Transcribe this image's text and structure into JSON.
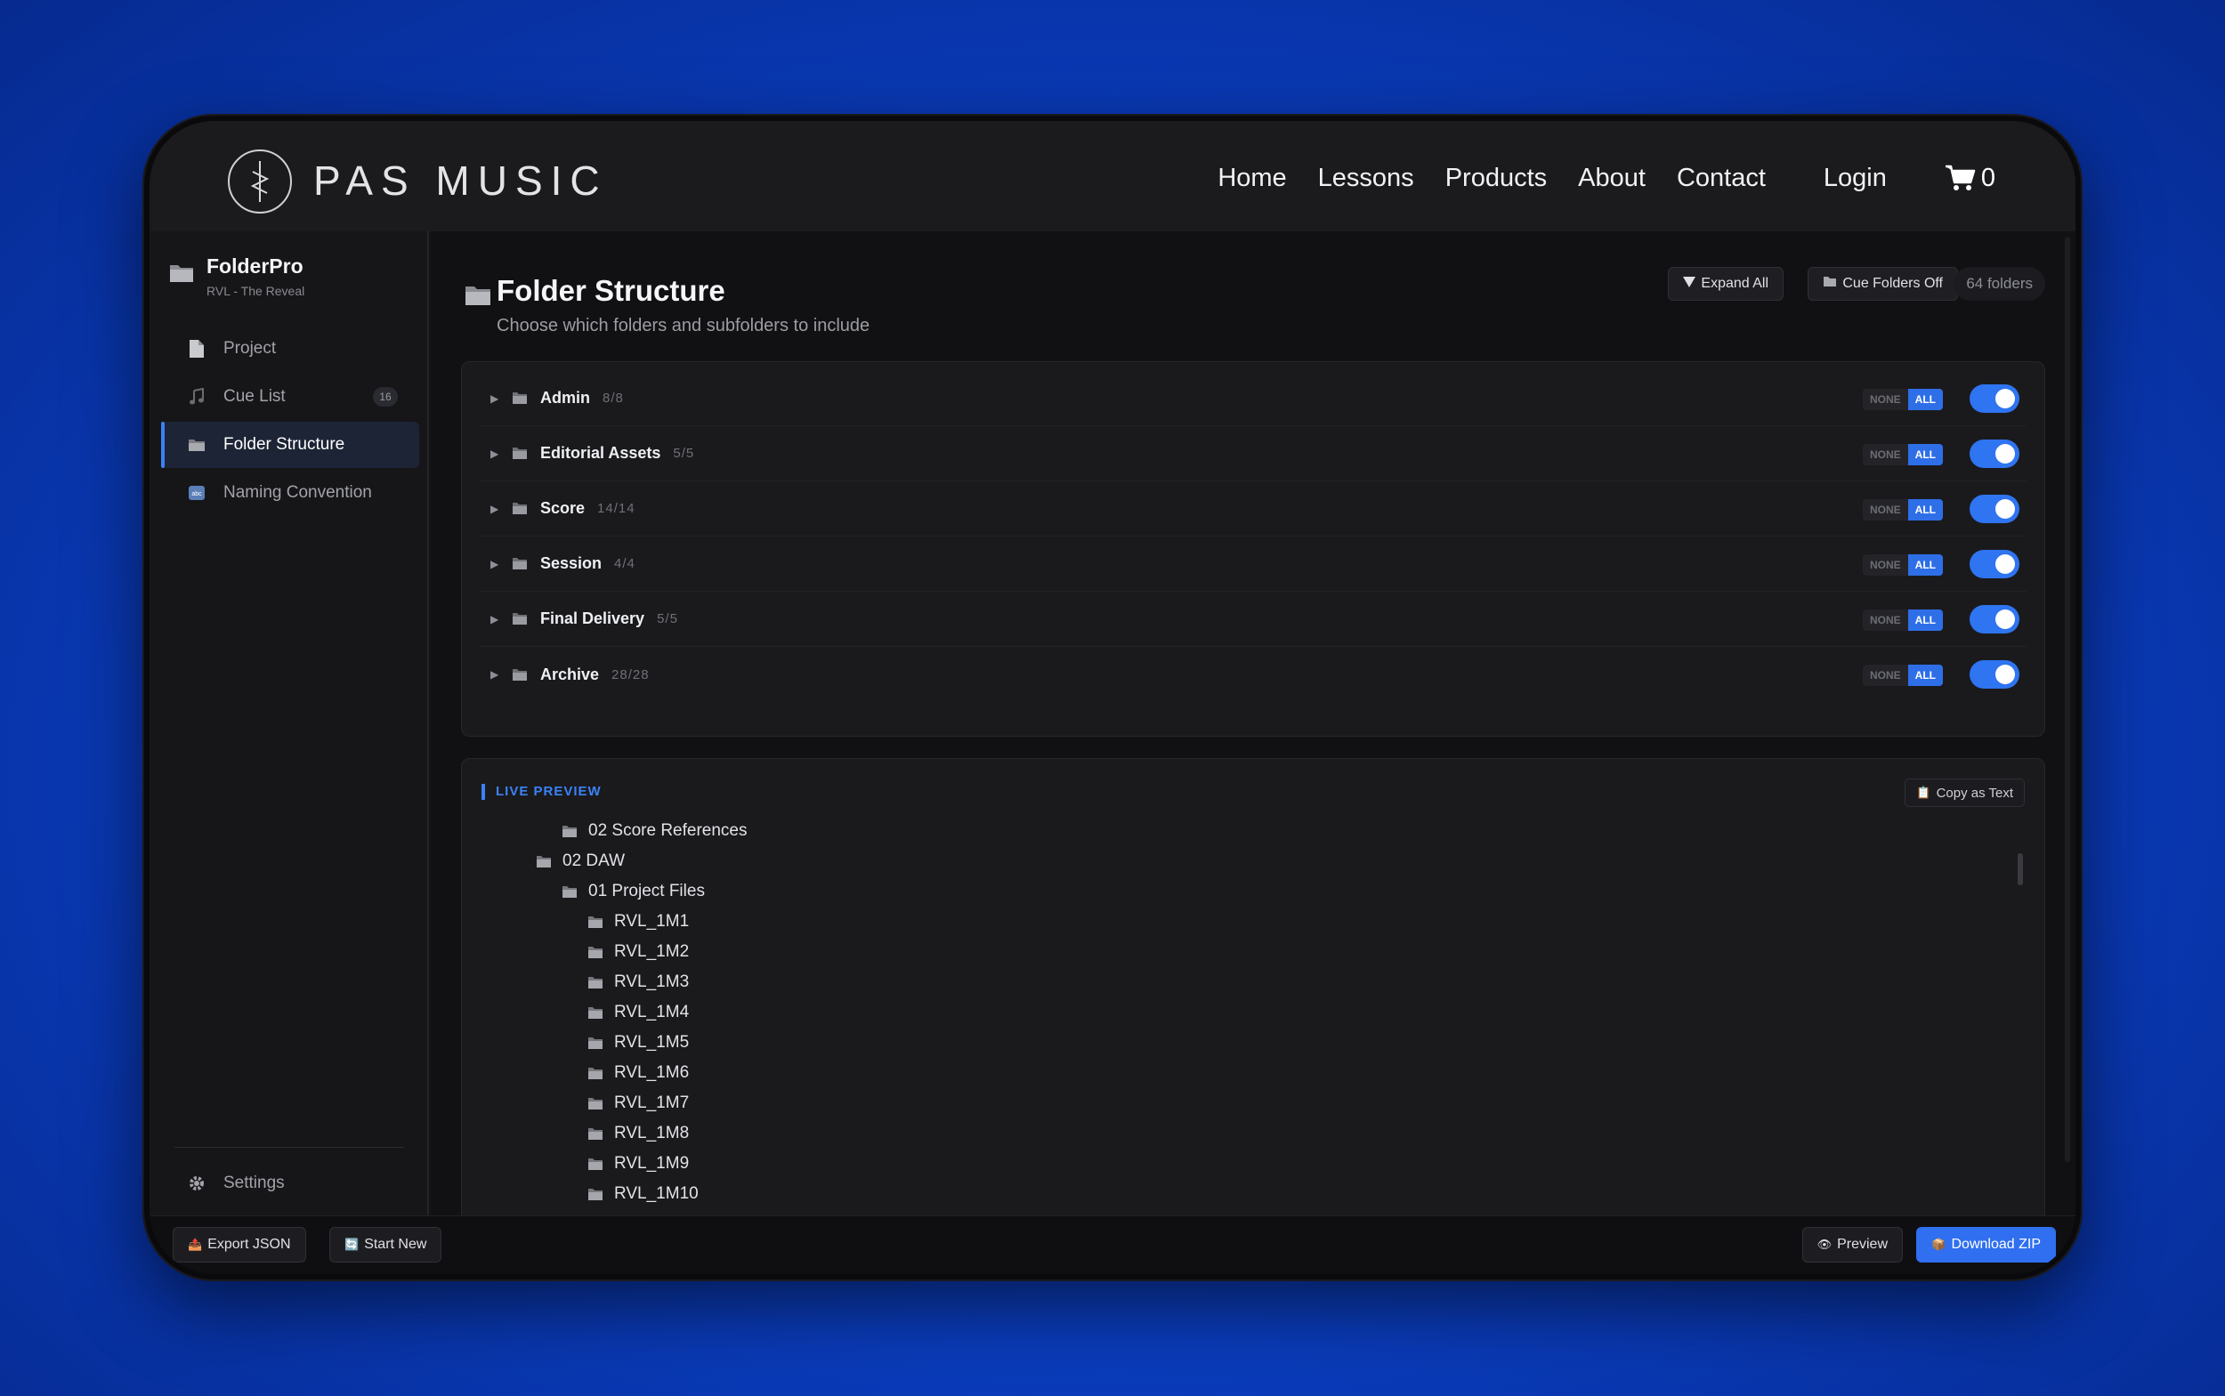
{
  "brand": {
    "logo_text": "PAS MUSIC"
  },
  "nav": {
    "links": [
      "Home",
      "Lessons",
      "Products",
      "About",
      "Contact"
    ],
    "login": "Login",
    "cart_count": "0"
  },
  "sidebar": {
    "app_title": "FolderPro",
    "project_name": "RVL - The Reveal",
    "items": [
      {
        "label": "Project",
        "icon": "document-icon"
      },
      {
        "label": "Cue List",
        "icon": "music-note-icon",
        "badge": "16"
      },
      {
        "label": "Folder Structure",
        "icon": "folder-icon",
        "active": true
      },
      {
        "label": "Naming Convention",
        "icon": "abc-icon"
      }
    ],
    "settings": "Settings"
  },
  "main": {
    "title": "Folder Structure",
    "subtitle": "Choose which folders and subfolders to include",
    "expand_all": "Expand All",
    "cue_folders": "Cue Folders Off",
    "folder_count": "64 folders",
    "folders": [
      {
        "name": "Admin",
        "count": "8/8",
        "enabled": true
      },
      {
        "name": "Editorial Assets",
        "count": "5/5",
        "enabled": true
      },
      {
        "name": "Score",
        "count": "14/14",
        "enabled": true
      },
      {
        "name": "Session",
        "count": "4/4",
        "enabled": true
      },
      {
        "name": "Final Delivery",
        "count": "5/5",
        "enabled": true
      },
      {
        "name": "Archive",
        "count": "28/28",
        "enabled": true
      }
    ],
    "none_label": "NONE",
    "all_label": "ALL",
    "preview": {
      "label": "LIVE PREVIEW",
      "copy_button": "Copy as Text",
      "tree": [
        {
          "name": "02 Score References",
          "depth": 2
        },
        {
          "name": "02 DAW",
          "depth": 1
        },
        {
          "name": "01 Project Files",
          "depth": 2
        },
        {
          "name": "RVL_1M1",
          "depth": 3
        },
        {
          "name": "RVL_1M2",
          "depth": 3
        },
        {
          "name": "RVL_1M3",
          "depth": 3
        },
        {
          "name": "RVL_1M4",
          "depth": 3
        },
        {
          "name": "RVL_1M5",
          "depth": 3
        },
        {
          "name": "RVL_1M6",
          "depth": 3
        },
        {
          "name": "RVL_1M7",
          "depth": 3
        },
        {
          "name": "RVL_1M8",
          "depth": 3
        },
        {
          "name": "RVL_1M9",
          "depth": 3
        },
        {
          "name": "RVL_1M10",
          "depth": 3
        }
      ]
    }
  },
  "bottom": {
    "export_json": "Export JSON",
    "start_new": "Start New",
    "preview": "Preview",
    "download_zip": "Download ZIP"
  },
  "colors": {
    "accent": "#2f6ff0",
    "background": "#111113",
    "sidebar_active": "#1d2436"
  }
}
